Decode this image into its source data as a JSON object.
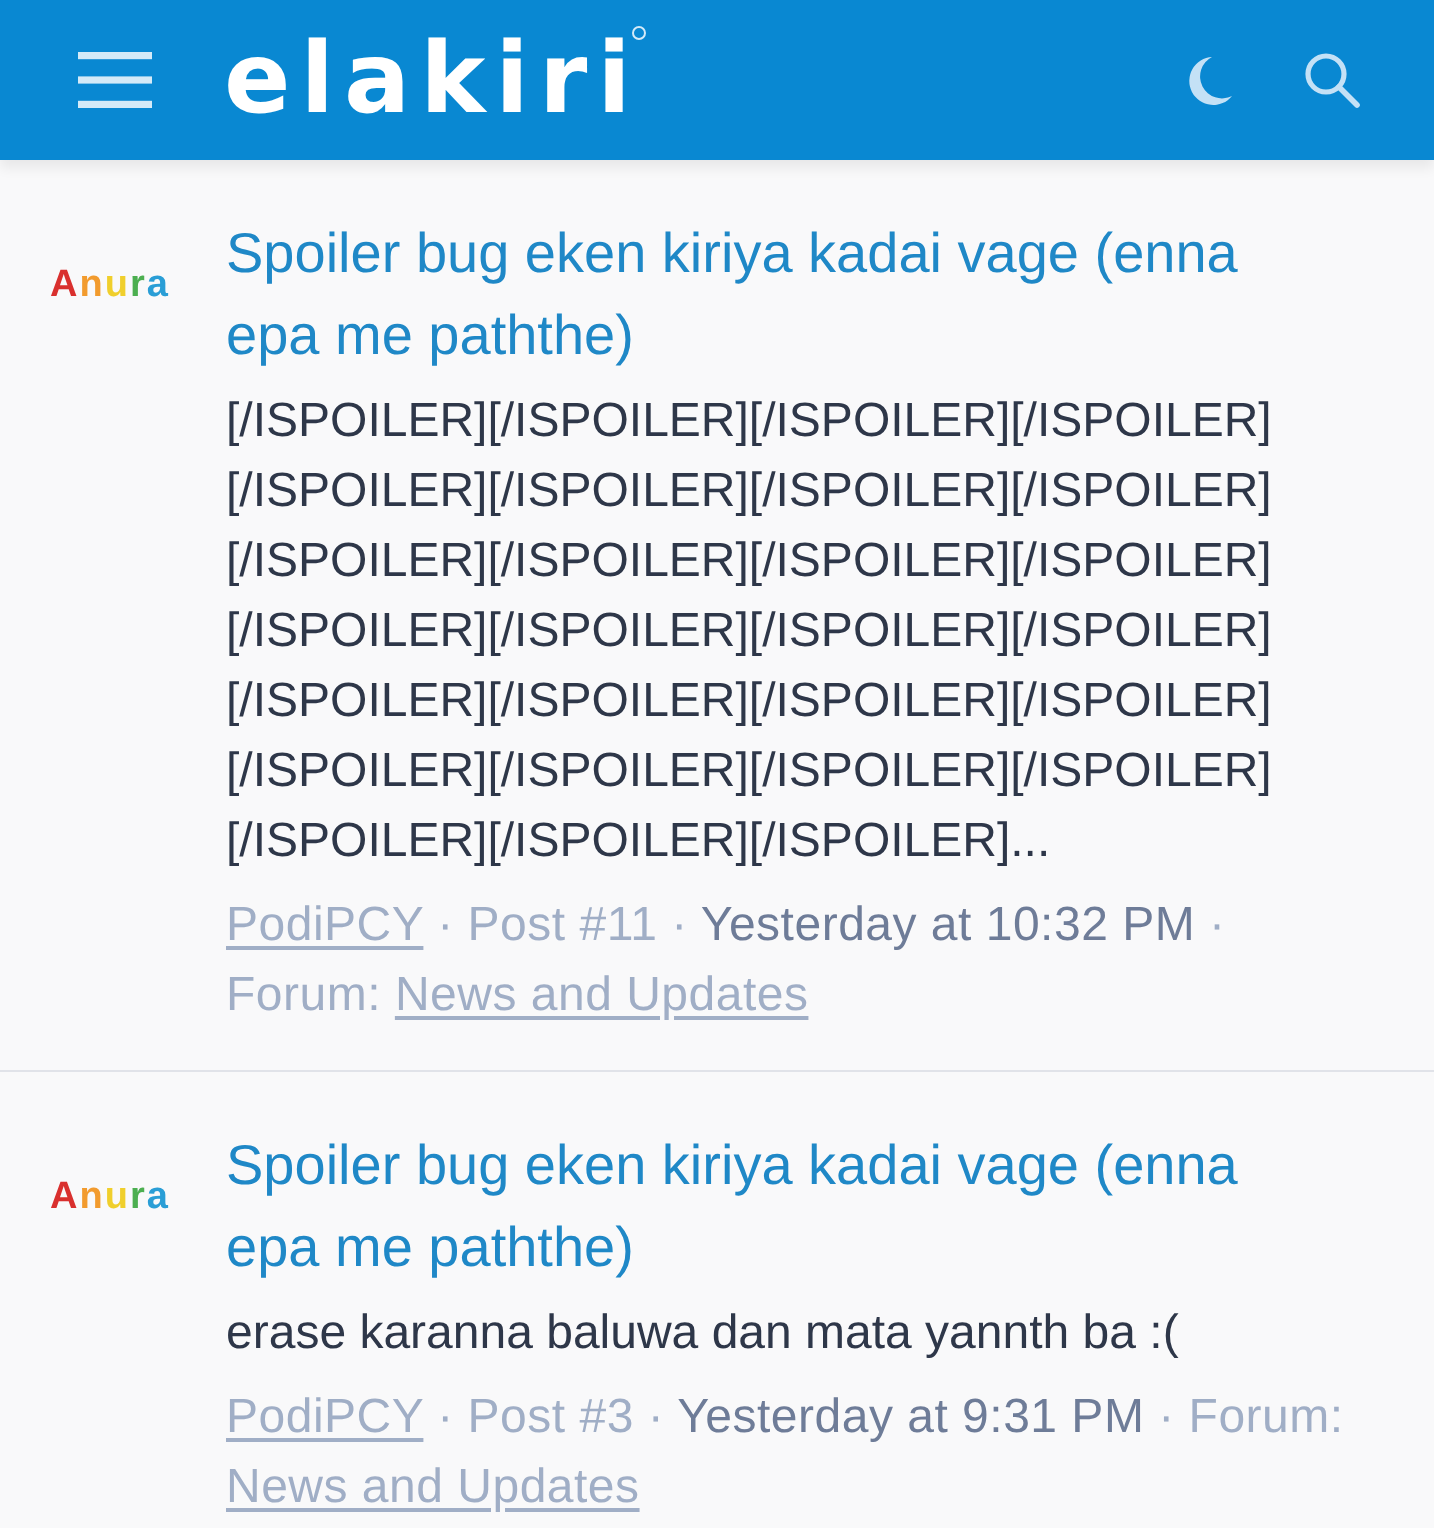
{
  "header": {
    "logo": "elakiri"
  },
  "posts": [
    {
      "avatar": "Anura",
      "title": "Spoiler bug eken kiriya kadai vage (enna epa me paththe)",
      "snippet": "[/ISPOILER][/ISPOILER][/ISPOILER][/ISPOILER][/ISPOILER][/ISPOILER][/ISPOILER][/ISPOILER][/ISPOILER][/ISPOILER][/ISPOILER][/ISPOILER][/ISPOILER][/ISPOILER][/ISPOILER][/ISPOILER][/ISPOILER][/ISPOILER][/ISPOILER][/ISPOILER][/ISPOILER][/ISPOILER][/ISPOILER][/ISPOILER][/ISPOILER][/ISPOILER][/ISPOILER]...",
      "meta": [
        {
          "kind": "author",
          "text": "PodiPCY"
        },
        {
          "kind": "separator",
          "text": "·"
        },
        {
          "kind": "post",
          "text": "Post #11"
        },
        {
          "kind": "separator",
          "text": "·"
        },
        {
          "kind": "date",
          "text": "Yesterday at 10:32 PM"
        },
        {
          "kind": "separator",
          "text": "·"
        },
        {
          "kind": "label",
          "text": "Forum:"
        },
        {
          "kind": "forum",
          "text": "News and Updates"
        }
      ]
    },
    {
      "avatar": "Anura",
      "title": "Spoiler bug eken kiriya kadai vage (enna epa me paththe)",
      "snippet": "erase karanna baluwa dan mata yannth ba :(",
      "meta": [
        {
          "kind": "author",
          "text": "PodiPCY"
        },
        {
          "kind": "separator",
          "text": "·"
        },
        {
          "kind": "post",
          "text": "Post #3"
        },
        {
          "kind": "separator",
          "text": "·"
        },
        {
          "kind": "date",
          "text": "Yesterday at 9:31 PM"
        },
        {
          "kind": "separator",
          "text": "·"
        },
        {
          "kind": "label",
          "text": "Forum:"
        },
        {
          "kind": "forum",
          "text": "News and Updates"
        }
      ]
    }
  ]
}
